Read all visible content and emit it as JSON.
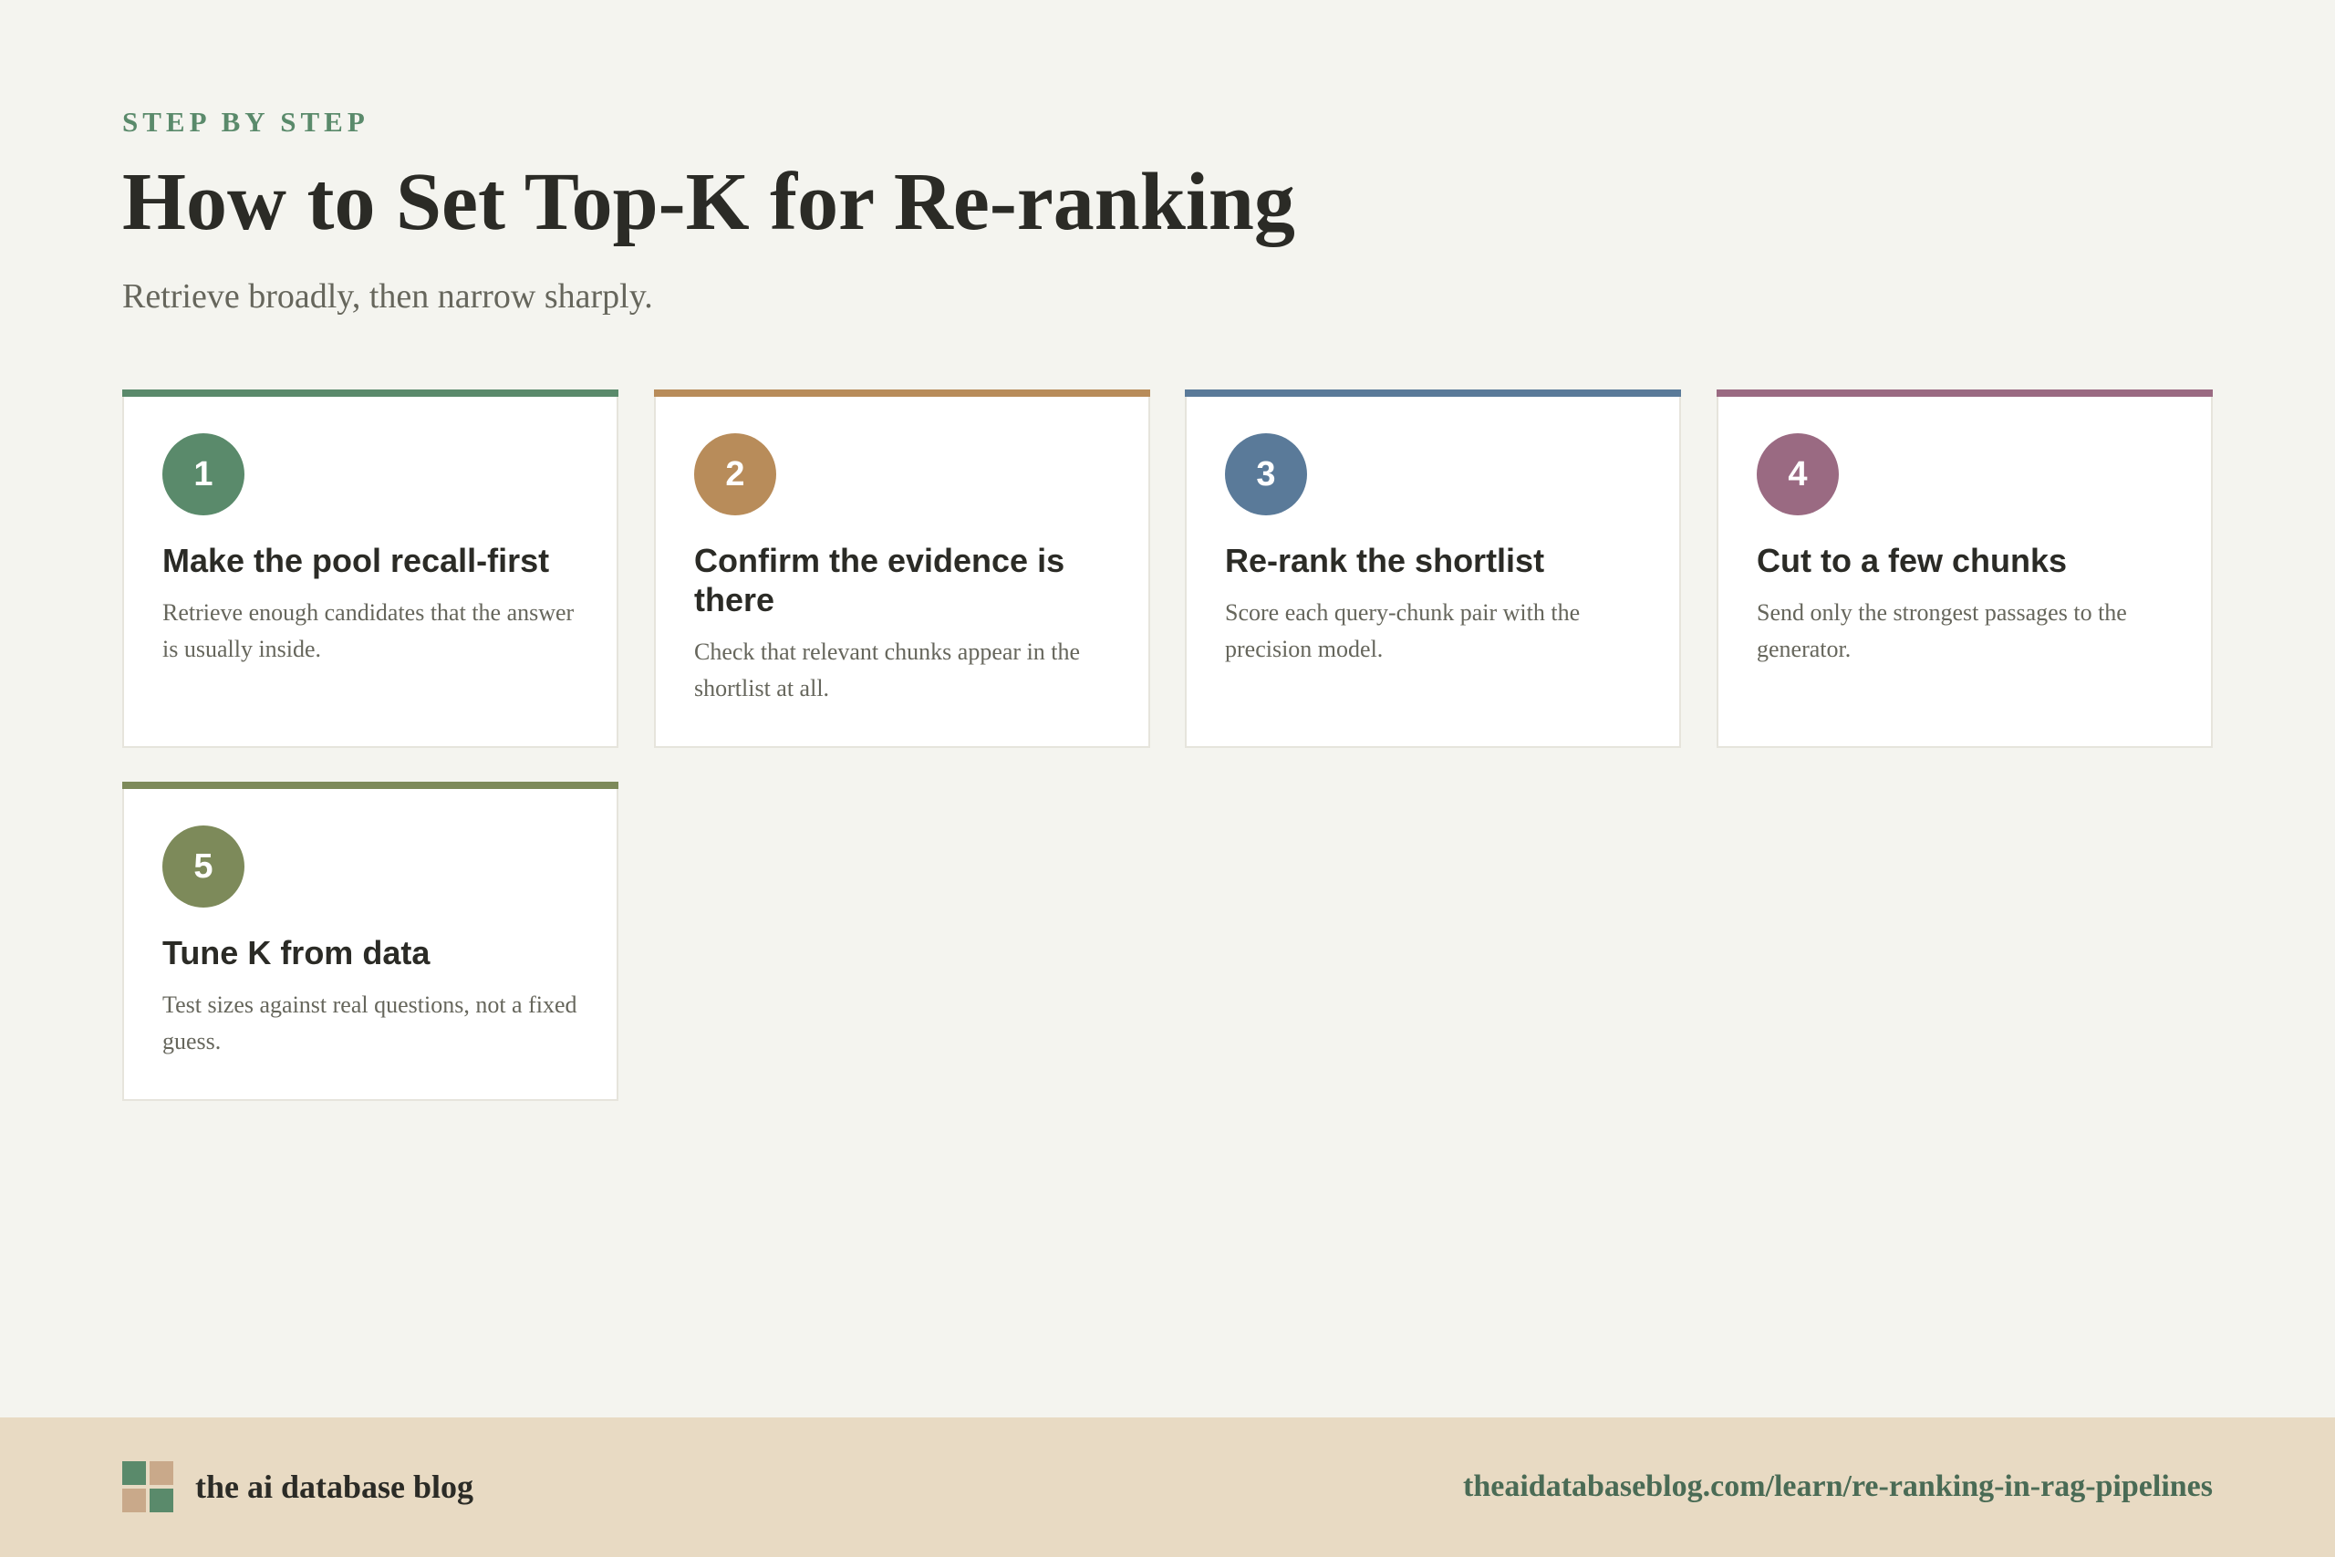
{
  "header": {
    "eyebrow": "STEP BY STEP",
    "title": "How to Set Top-K for Re-ranking",
    "subtitle": "Retrieve broadly, then narrow sharply."
  },
  "steps": [
    {
      "number": "1",
      "title": "Make the pool recall-first",
      "description": "Retrieve enough candidates that the answer is usually inside.",
      "color": "#5a8a6b"
    },
    {
      "number": "2",
      "title": "Confirm the evidence is there",
      "description": "Check that relevant chunks appear in the shortlist at all.",
      "color": "#b88c5a"
    },
    {
      "number": "3",
      "title": "Re-rank the shortlist",
      "description": "Score each query-chunk pair with the precision model.",
      "color": "#5a7a99"
    },
    {
      "number": "4",
      "title": "Cut to a few chunks",
      "description": "Send only the strongest passages to the generator.",
      "color": "#9a6a82"
    },
    {
      "number": "5",
      "title": "Tune K from data",
      "description": "Test sizes against real questions, not a fixed guess.",
      "color": "#7d8a5a"
    }
  ],
  "footer": {
    "brand": "the ai database blog",
    "url": "theaidatabaseblog.com/learn/re-ranking-in-rag-pipelines",
    "logo_colors": [
      "#5a8a6b",
      "#c9a98a",
      "#c9a98a",
      "#5a8a6b"
    ]
  }
}
